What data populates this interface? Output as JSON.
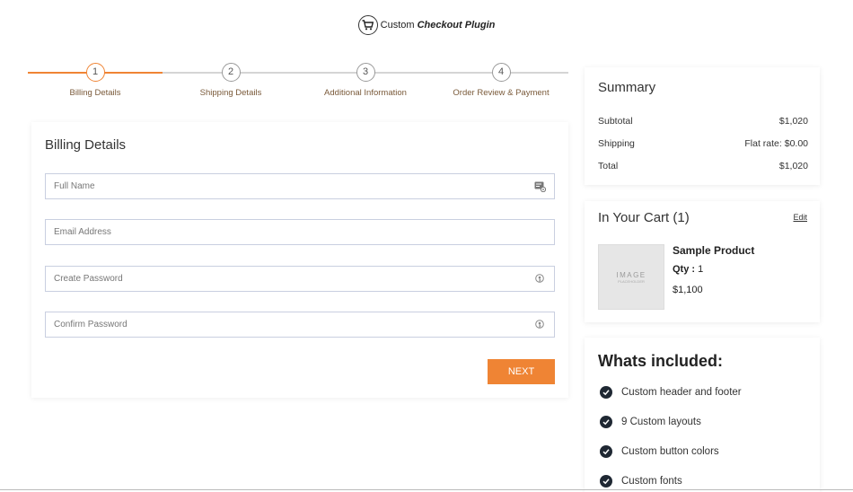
{
  "header": {
    "logo_icon": "shopping-cart-icon",
    "brand_prefix": "Custom",
    "brand_strong": "Checkout Plugin"
  },
  "stepper": {
    "steps": [
      {
        "number": "1",
        "label": "Billing Details",
        "active": true
      },
      {
        "number": "2",
        "label": "Shipping Details",
        "active": false
      },
      {
        "number": "3",
        "label": "Additional Information",
        "active": false
      },
      {
        "number": "4",
        "label": "Order Review & Payment",
        "active": false
      }
    ]
  },
  "billing": {
    "title": "Billing Details",
    "fields": [
      {
        "placeholder": "Full Name",
        "icon": "contact-card-icon"
      },
      {
        "placeholder": "Email Address",
        "icon": ""
      },
      {
        "placeholder": "Create Password",
        "icon": "key-icon"
      },
      {
        "placeholder": "Confirm Password",
        "icon": "key-icon"
      }
    ],
    "next_label": "NEXT"
  },
  "summary": {
    "title": "Summary",
    "rows": [
      {
        "label": "Subtotal",
        "value": "$1,020"
      },
      {
        "label": "Shipping",
        "value": "Flat rate: $0.00"
      },
      {
        "label": "Total",
        "value": "$1,020"
      }
    ]
  },
  "cart": {
    "title": "In Your Cart (1)",
    "edit_label": "Edit",
    "image_text": "IMAGE",
    "image_subtext": "PLACEHOLDER",
    "product_name": "Sample Product",
    "qty_label": "Qty :",
    "qty_value": "1",
    "price": "$1,100"
  },
  "included": {
    "title": "Whats included:",
    "items": [
      "Custom header and footer",
      "9 Custom layouts",
      "Custom button colors",
      "Custom fonts"
    ]
  },
  "colors": {
    "accent": "#ef8434",
    "check": "#1f2833"
  }
}
